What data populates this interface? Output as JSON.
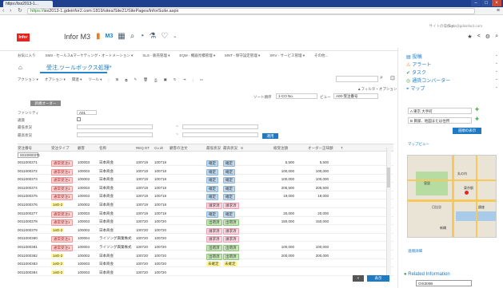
{
  "browser": {
    "tab_title": "https://isx2013-1...",
    "url_scheme": "https://",
    "url_rest": "isx2013-1.gdeinfor2.com:1819/sites/Site21/SitePages/InforSuite.aspx",
    "win_buttons": [
      "–",
      "□",
      "×"
    ]
  },
  "app": {
    "logo": "Infor",
    "title": "Infor M3",
    "m3_label": "M3",
    "user": "nogbi@gdsinfor2.com",
    "site_actions": "サイトの操作 ▾"
  },
  "topnav": [
    "お気に入り",
    "SMS - セールス&マーケティング・オートメーション ▾",
    "SLS - 販売管理 ▾",
    "EQM - 機器見積管理 ▾",
    "MNT - 保守設定管理 ▾",
    "SRV - サービス管理 ▾",
    "その他..."
  ],
  "page": {
    "title": "受注,ツールボックス処理",
    "title_suffix": "*"
  },
  "toolbar": {
    "items": [
      "アクション ▾",
      "オプション ▾",
      "関連 ▾",
      "ツール ▾"
    ]
  },
  "filter": {
    "link": "▲フィルタ・オプション",
    "sort_label": "ソート順序",
    "sort_value": "1-CO No.",
    "view_label": "ビュー",
    "view_value": "A00-受注番号"
  },
  "form": {
    "button": "新規オーダー",
    "fields": [
      {
        "label": "ファシリティ",
        "value": "A01"
      },
      {
        "label": "通貨",
        "value": ""
      },
      {
        "label": "最低状況",
        "value": ""
      },
      {
        "label": "最高状況",
        "value": ""
      }
    ],
    "search_button": "適用"
  },
  "grid": {
    "columns": [
      "受注番号",
      "受注タイプ",
      "顧客",
      "名称",
      "REQ DT",
      "Cu dt",
      "顧客の注文",
      "最低状況",
      "最高状況",
      "S",
      "総受注額",
      "オーダー正味額",
      "T"
    ],
    "filter_value": "0010000371",
    "rows": [
      [
        "0011000371",
        "通常受注1",
        "100003",
        "日本商会",
        "100719",
        "100718",
        "",
        "確定",
        "確定",
        "",
        "5,500",
        "5,500"
      ],
      [
        "0011000372",
        "通常受注1",
        "100003",
        "日本商会",
        "100719",
        "100718",
        "",
        "確定",
        "確定",
        "",
        "100,000",
        "100,000"
      ],
      [
        "0011000373",
        "通常受注1",
        "100003",
        "日本商会",
        "100719",
        "100718",
        "",
        "確定",
        "確定",
        "",
        "100,000",
        "100,000"
      ],
      [
        "0011000374",
        "通常受注1",
        "100003",
        "日本商会",
        "100719",
        "100718",
        "",
        "確定",
        "確定",
        "",
        "205,500",
        "205,500"
      ],
      [
        "0011000375",
        "通常受注1",
        "100003",
        "日本商会",
        "100719",
        "100718",
        "",
        "確定",
        "確定",
        "",
        "19,000",
        "19,000"
      ],
      [
        "0011000376",
        "1eD-2",
        "100003",
        "日本商会",
        "100719",
        "100718",
        "",
        "請求済",
        "請求済",
        "",
        "",
        ""
      ],
      [
        "0011000377",
        "通常受注1",
        "100003",
        "日本商会",
        "100719",
        "100718",
        "",
        "確定",
        "確定",
        "",
        "20,000",
        "20,000"
      ],
      [
        "0011000378",
        "通常受注1",
        "100003",
        "日本商会",
        "100720",
        "100720",
        "",
        "出荷済",
        "出荷済",
        "",
        "150,000",
        "150,000"
      ],
      [
        "0011000379",
        "1eD-2",
        "100003",
        "日本商会",
        "100720",
        "100720",
        "",
        "請求済",
        "請求済",
        "",
        "",
        ""
      ],
      [
        "0011000380",
        "通常受注1",
        "100004",
        "ライソング興業株式",
        "100720",
        "100720",
        "",
        "請求済",
        "請求済",
        "",
        "",
        ""
      ],
      [
        "0011000381",
        "通常受注1",
        "100004",
        "ライソング興業株式",
        "100720",
        "100720",
        "",
        "出荷済",
        "出荷済",
        "",
        "100,000",
        "100,000"
      ],
      [
        "0011000382",
        "1eD-2",
        "100003",
        "日本商会",
        "100720",
        "100720",
        "",
        "出荷済",
        "出荷済",
        "",
        "200,000",
        "200,000"
      ],
      [
        "0011000383",
        "1eD-2",
        "100003",
        "日本商会",
        "100720",
        "100720",
        "",
        "未確定",
        "未確定",
        "",
        "",
        ""
      ],
      [
        "0011000384",
        "1eD-2",
        "100003",
        "日本商会",
        "100720",
        "100720",
        "",
        "",
        "",
        "",
        "",
        ""
      ]
    ]
  },
  "pager": {
    "prev": "<",
    "next": "表示"
  },
  "right_panel": {
    "items": [
      "投稿",
      "アラート",
      "タスク",
      "通貨コンバーター",
      "マップ"
    ],
    "map_from": "A 東京 大手町",
    "map_to": "B 目録、地図または住所",
    "route_button": "道順の表示",
    "map_header": "マップビュー",
    "map_labels": [
      "皇居",
      "東京駅",
      "日比谷",
      "新橋",
      "丸の内",
      "銀座"
    ],
    "route_detail": "道順詳細",
    "related_label": "Related Information",
    "related_value": "OIS300B"
  }
}
